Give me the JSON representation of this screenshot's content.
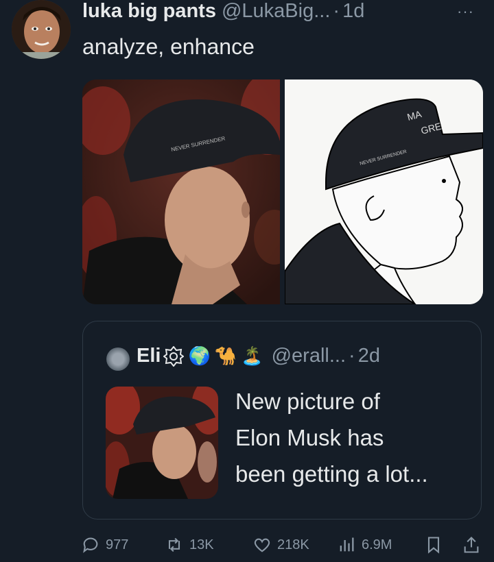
{
  "post": {
    "display_name": "luka big pants",
    "handle": "@LukaBig...",
    "separator": "·",
    "time": "1d",
    "more_icon": "more-icon",
    "text": "analyze, enhance"
  },
  "media": {
    "sketch_text_hat_front": "MA",
    "sketch_text_hat_front2": "GRE",
    "sketch_text_hat_side": "NEVER SURRENDER"
  },
  "quote": {
    "display_name": "Eli",
    "emojis": [
      "🌍",
      "🐪",
      "🏝️"
    ],
    "handle": "@erall...",
    "separator": "·",
    "time": "2d",
    "text_lines": [
      "New picture of",
      "Elon Musk has",
      "been getting a lot..."
    ]
  },
  "actions": {
    "replies": "977",
    "reposts": "13K",
    "likes": "218K",
    "views": "6.9M"
  },
  "colors": {
    "background": "#151d27",
    "text": "#e7e9ea",
    "muted": "#8b98a5",
    "border": "#2f3b47"
  }
}
